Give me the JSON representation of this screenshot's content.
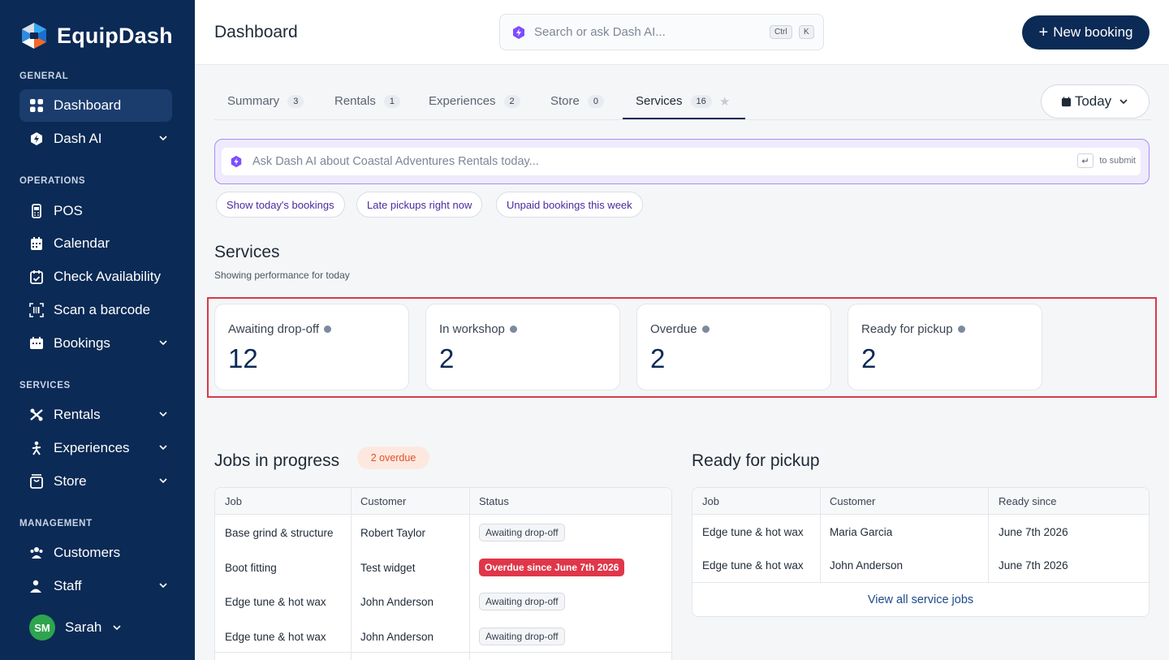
{
  "brand": {
    "name": "EquipDash"
  },
  "sidebar": {
    "sections": [
      {
        "label": "GENERAL"
      },
      {
        "label": "OPERATIONS"
      },
      {
        "label": "SERVICES"
      },
      {
        "label": "MANAGEMENT"
      }
    ],
    "items": [
      {
        "label": "Dashboard",
        "icon": "dashboard-grid-icon",
        "active": true
      },
      {
        "label": "Dash AI",
        "icon": "dash-ai-icon",
        "expandable": true
      },
      {
        "label": "POS",
        "icon": "pos-terminal-icon"
      },
      {
        "label": "Calendar",
        "icon": "calendar-icon"
      },
      {
        "label": "Check Availability",
        "icon": "calendar-check-icon"
      },
      {
        "label": "Scan a barcode",
        "icon": "barcode-icon"
      },
      {
        "label": "Bookings",
        "icon": "bookings-icon",
        "expandable": true
      },
      {
        "label": "Rentals",
        "icon": "rentals-icon",
        "expandable": true
      },
      {
        "label": "Experiences",
        "icon": "experiences-icon",
        "expandable": true
      },
      {
        "label": "Store",
        "icon": "store-bag-icon",
        "expandable": true
      },
      {
        "label": "Customers",
        "icon": "customers-icon"
      },
      {
        "label": "Staff",
        "icon": "staff-icon",
        "expandable": true
      }
    ],
    "user": {
      "initials": "SM",
      "name": "Sarah",
      "avatar_color": "#2ea44f"
    }
  },
  "header": {
    "title": "Dashboard",
    "search_placeholder": "Search or ask Dash AI...",
    "shortcut": [
      "Ctrl",
      "K"
    ],
    "new_booking_label": "New booking"
  },
  "tabs": [
    {
      "label": "Summary",
      "count": "3"
    },
    {
      "label": "Rentals",
      "count": "1"
    },
    {
      "label": "Experiences",
      "count": "2"
    },
    {
      "label": "Store",
      "count": "0"
    },
    {
      "label": "Services",
      "count": "16",
      "active": true
    }
  ],
  "date_filter": {
    "label": "Today"
  },
  "ai_prompt": {
    "placeholder": "Ask Dash AI about Coastal Adventures Rentals today...",
    "enter_key": "↵",
    "submit_hint": "to submit",
    "suggestions": [
      "Show today's bookings",
      "Late pickups right now",
      "Unpaid bookings this week"
    ]
  },
  "services": {
    "title": "Services",
    "subtitle": "Showing performance for today",
    "stats": [
      {
        "label": "Awaiting drop-off",
        "value": "12"
      },
      {
        "label": "In workshop",
        "value": "2"
      },
      {
        "label": "Overdue",
        "value": "2"
      },
      {
        "label": "Ready for pickup",
        "value": "2"
      }
    ]
  },
  "jobs_in_progress": {
    "title": "Jobs in progress",
    "badge": "2 overdue",
    "columns": [
      "Job",
      "Customer",
      "Status"
    ],
    "rows": [
      {
        "job": "Base grind & structure",
        "customer": "Robert Taylor",
        "status": "Awaiting drop-off",
        "overdue": false
      },
      {
        "job": "Boot fitting",
        "customer": "Test widget",
        "status": "Overdue since June 7th 2026",
        "overdue": true
      },
      {
        "job": "Edge tune & hot wax",
        "customer": "John Anderson",
        "status": "Awaiting drop-off",
        "overdue": false
      },
      {
        "job": "Edge tune & hot wax",
        "customer": "John Anderson",
        "status": "Awaiting drop-off",
        "overdue": false
      }
    ]
  },
  "ready_for_pickup": {
    "title": "Ready for pickup",
    "columns": [
      "Job",
      "Customer",
      "Ready since"
    ],
    "rows": [
      {
        "job": "Edge tune & hot wax",
        "customer": "Maria Garcia",
        "ready_since": "June 7th 2026"
      },
      {
        "job": "Edge tune & hot wax",
        "customer": "John Anderson",
        "ready_since": "June 7th 2026"
      }
    ],
    "view_all_label": "View all service jobs"
  },
  "colors": {
    "sidebar_bg": "#0b2a55",
    "accent": "#0b2a55",
    "ai_purple": "#7c4dff",
    "overdue_red": "#e0364a",
    "highlight_border": "#d63a4a"
  }
}
